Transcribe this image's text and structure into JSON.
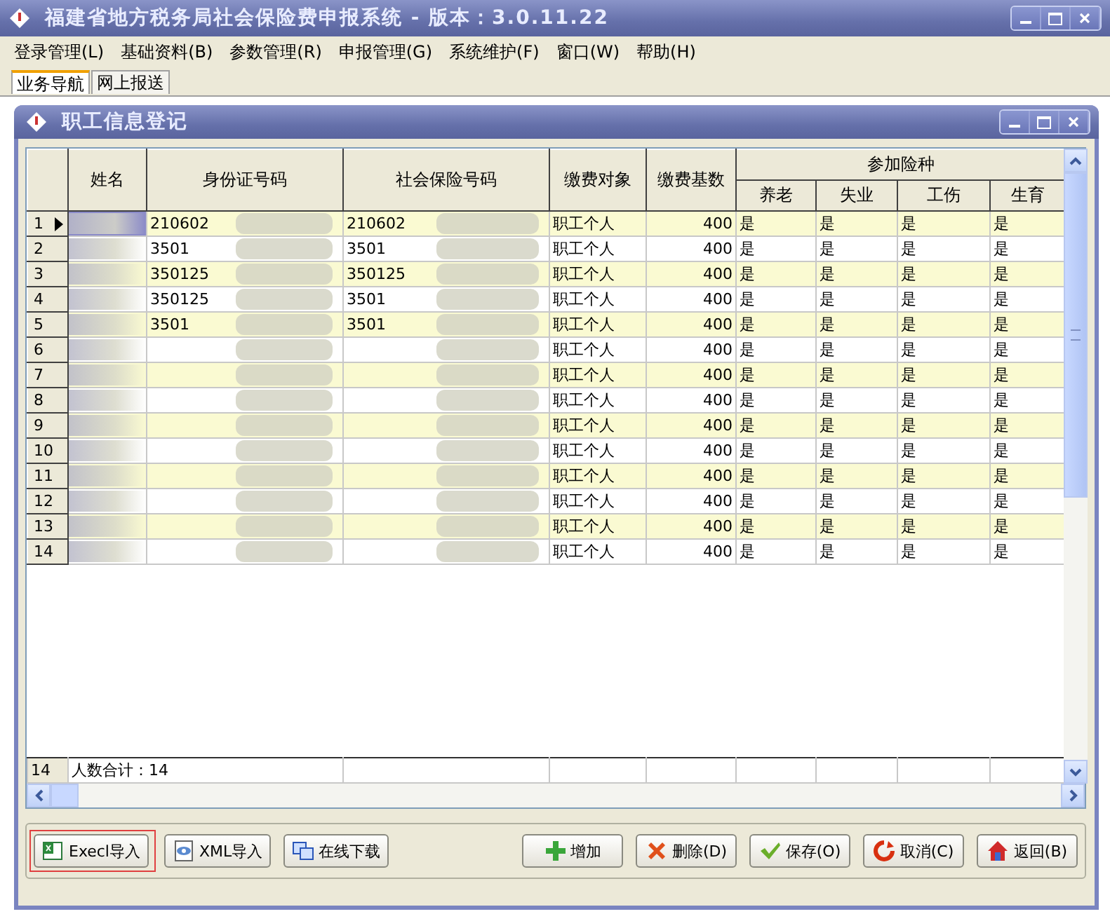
{
  "app_window": {
    "title": "福建省地方税务局社会保险费申报系统 - 版本：3.0.11.22"
  },
  "menu": [
    "登录管理(L)",
    "基础资料(B)",
    "参数管理(R)",
    "申报管理(G)",
    "系统维护(F)",
    "窗口(W)",
    "帮助(H)"
  ],
  "nav_tabs": [
    {
      "label": "业务导航",
      "selected": true
    },
    {
      "label": "网上报送",
      "selected": false
    }
  ],
  "child_window": {
    "title": "职工信息登记"
  },
  "grid": {
    "columns": [
      "姓名",
      "身份证号码",
      "社会保险号码",
      "缴费对象",
      "缴费基数"
    ],
    "group_label": "参加险种",
    "group_columns": [
      "养老",
      "失业",
      "工伤",
      "生育"
    ],
    "rows": [
      {
        "row_number": "1",
        "selected": true,
        "id_number": "210602",
        "insurance_number": "210602",
        "payer": "职工个人",
        "base": "400",
        "insurances": [
          "是",
          "是",
          "是",
          "是"
        ]
      },
      {
        "row_number": "2",
        "selected": false,
        "id_number": "3501",
        "insurance_number": "3501",
        "payer": "职工个人",
        "base": "400",
        "insurances": [
          "是",
          "是",
          "是",
          "是"
        ]
      },
      {
        "row_number": "3",
        "selected": false,
        "id_number": "350125",
        "insurance_number": "350125",
        "payer": "职工个人",
        "base": "400",
        "insurances": [
          "是",
          "是",
          "是",
          "是"
        ]
      },
      {
        "row_number": "4",
        "selected": false,
        "id_number": "350125",
        "insurance_number": "3501",
        "payer": "职工个人",
        "base": "400",
        "insurances": [
          "是",
          "是",
          "是",
          "是"
        ]
      },
      {
        "row_number": "5",
        "selected": false,
        "id_number": "3501",
        "insurance_number": "3501",
        "payer": "职工个人",
        "base": "400",
        "insurances": [
          "是",
          "是",
          "是",
          "是"
        ]
      },
      {
        "row_number": "6",
        "selected": false,
        "payer": "职工个人",
        "base": "400",
        "insurances": [
          "是",
          "是",
          "是",
          "是"
        ]
      },
      {
        "row_number": "7",
        "selected": false,
        "payer": "职工个人",
        "base": "400",
        "insurances": [
          "是",
          "是",
          "是",
          "是"
        ]
      },
      {
        "row_number": "8",
        "selected": false,
        "payer": "职工个人",
        "base": "400",
        "insurances": [
          "是",
          "是",
          "是",
          "是"
        ]
      },
      {
        "row_number": "9",
        "selected": false,
        "payer": "职工个人",
        "base": "400",
        "insurances": [
          "是",
          "是",
          "是",
          "是"
        ]
      },
      {
        "row_number": "10",
        "selected": false,
        "payer": "职工个人",
        "base": "400",
        "insurances": [
          "是",
          "是",
          "是",
          "是"
        ]
      },
      {
        "row_number": "11",
        "selected": false,
        "payer": "职工个人",
        "base": "400",
        "insurances": [
          "是",
          "是",
          "是",
          "是"
        ]
      },
      {
        "row_number": "12",
        "selected": false,
        "payer": "职工个人",
        "base": "400",
        "insurances": [
          "是",
          "是",
          "是",
          "是"
        ]
      },
      {
        "row_number": "13",
        "selected": false,
        "payer": "职工个人",
        "base": "400",
        "insurances": [
          "是",
          "是",
          "是",
          "是"
        ]
      },
      {
        "row_number": "14",
        "selected": false,
        "payer": "职工个人",
        "base": "400",
        "insurances": [
          "是",
          "是",
          "是",
          "是"
        ]
      }
    ],
    "footer": {
      "row_number": "14",
      "summary": "人数合计：14"
    }
  },
  "buttons": [
    {
      "label": "Execl导入",
      "kind": "excel",
      "highlighted": true
    },
    {
      "label": "XML导入",
      "kind": "xml",
      "highlighted": false
    },
    {
      "label": "在线下载",
      "kind": "download",
      "highlighted": false
    },
    {
      "label": "增加",
      "kind": "add",
      "highlighted": false
    },
    {
      "label": "删除(D)",
      "kind": "delete",
      "highlighted": false
    },
    {
      "label": "保存(O)",
      "kind": "save",
      "highlighted": false
    },
    {
      "label": "取消(C)",
      "kind": "cancel",
      "highlighted": false
    },
    {
      "label": "返回(B)",
      "kind": "back",
      "highlighted": false
    }
  ]
}
